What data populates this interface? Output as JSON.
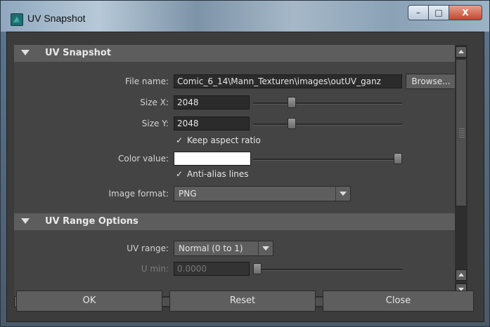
{
  "window": {
    "title": "UV Snapshot",
    "buttons": {
      "minimize": "–",
      "maximize": "□",
      "close": "X"
    }
  },
  "uv_snapshot": {
    "header": "UV Snapshot",
    "file_name_label": "File name:",
    "file_name_value": "Comic_6_14\\Mann_Texturen\\images\\outUV_ganz",
    "browse_label": "Browse...",
    "size_x_label": "Size X:",
    "size_x_value": "2048",
    "size_y_label": "Size Y:",
    "size_y_value": "2048",
    "keep_aspect_label": "Keep aspect ratio",
    "keep_aspect_checked": true,
    "color_value_label": "Color value:",
    "color_value": "#ffffff",
    "anti_alias_label": "Anti-alias lines",
    "anti_alias_checked": true,
    "image_format_label": "Image format:",
    "image_format_value": "PNG"
  },
  "uv_range_options": {
    "header": "UV Range Options",
    "uv_range_label": "UV range:",
    "uv_range_value": "Normal (0 to 1)",
    "u_min_label": "U min:",
    "u_min_value": "0.0000"
  },
  "footer": {
    "ok_label": "OK",
    "reset_label": "Reset",
    "close_label": "Close"
  }
}
